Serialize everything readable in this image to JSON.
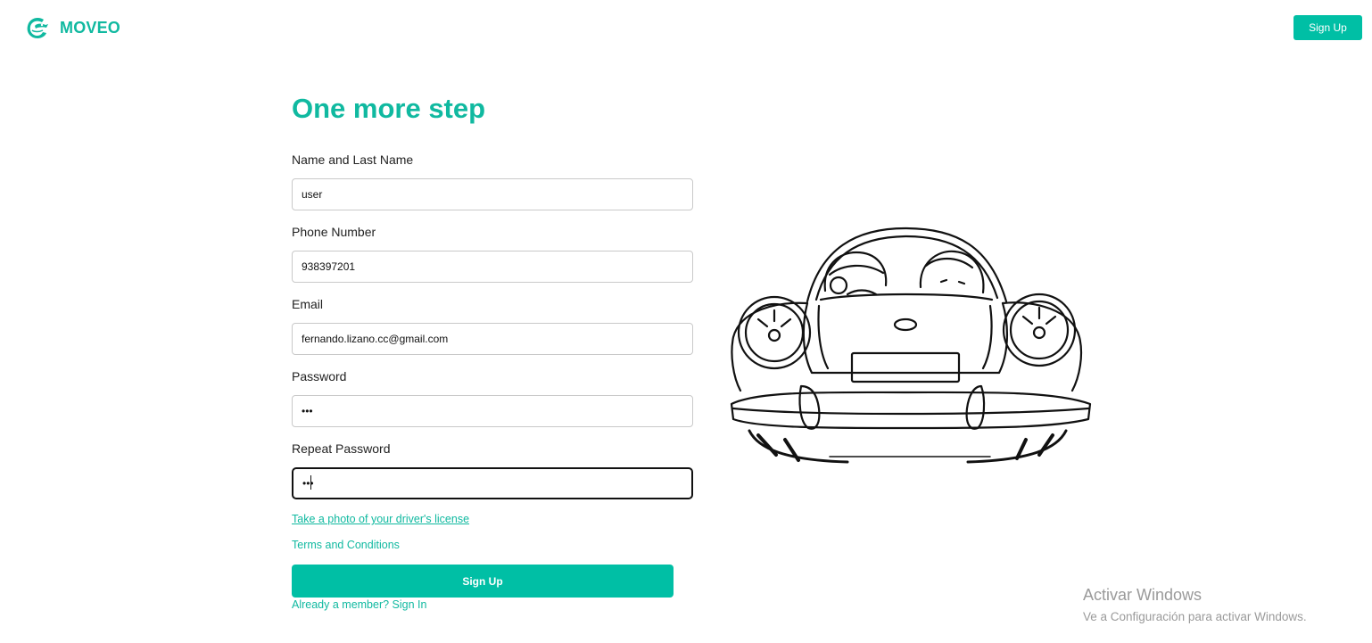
{
  "header": {
    "brand_name": "MOVEO",
    "signup_label": "Sign Up",
    "accent_color": "#00bfa5"
  },
  "form": {
    "title": "One more step",
    "fields": [
      {
        "label": "Name and Last Name",
        "value": "user"
      },
      {
        "label": "Phone Number",
        "value": "938397201"
      },
      {
        "label": "Email",
        "value": "fernando.lizano.cc@gmail.com"
      },
      {
        "label": "Password",
        "value": "•••"
      },
      {
        "label": "Repeat Password",
        "value": "•••"
      }
    ],
    "license_link": "Take a photo of your driver's license",
    "terms_link": "Terms and Conditions",
    "submit_label": "Sign Up",
    "signin_link": "Already a member? Sign In"
  },
  "illustration": {
    "icon": "car-with-passengers-illustration"
  },
  "watermark": {
    "title": "Activar Windows",
    "subtitle": "Ve a Configuración para activar Windows."
  }
}
